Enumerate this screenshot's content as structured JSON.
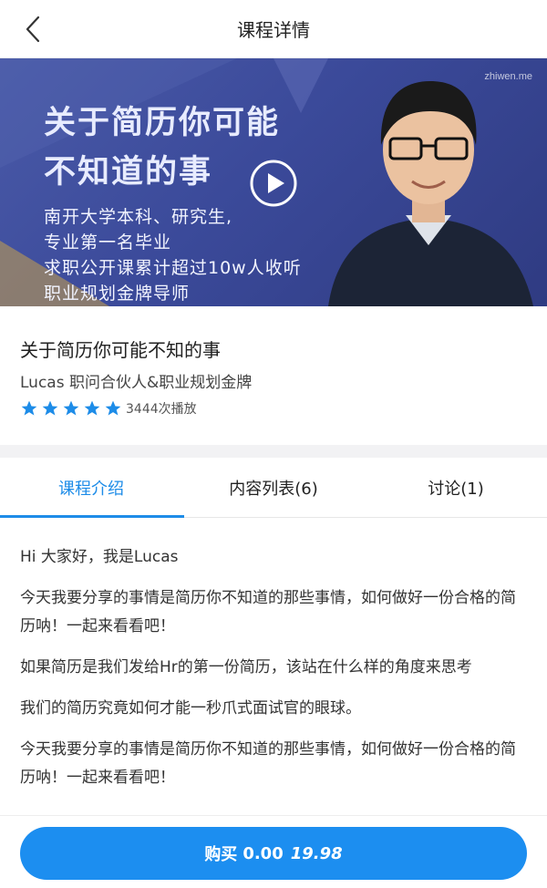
{
  "nav": {
    "title": "课程详情",
    "back_icon": "chevron-left-icon"
  },
  "banner": {
    "headline": "关于简历你可能\n不知道的事",
    "bullets": [
      "南开大学本科、研究生,",
      "专业第一名毕业",
      "求职公开课累计超过10w人收听",
      "职业规划金牌导师"
    ],
    "brand": "zhiwen.me",
    "play_icon": "play-icon"
  },
  "course": {
    "title": "关于简历你可能不知的事",
    "author": "Lucas 职问合伙人&职业规划金牌",
    "rating": 5,
    "plays": "3444次播放"
  },
  "tabs": [
    {
      "label": "课程介绍",
      "active": true
    },
    {
      "label": "内容列表(6)",
      "active": false
    },
    {
      "label": "讨论(1)",
      "active": false
    }
  ],
  "content": [
    "Hi 大家好，我是Lucas",
    "今天我要分享的事情是简历你不知道的那些事情，如何做好一份合格的简历呐！一起来看看吧！",
    "如果简历是我们发给Hr的第一份简历，该站在什么样的角度来思考",
    "我们的简历究竟如何才能一秒爪式面试官的眼球。",
    "今天我要分享的事情是简历你不知道的那些事情，如何做好一份合格的简历呐！一起来看看吧！"
  ],
  "buy": {
    "label": "购买",
    "price": "0.00",
    "original_price": "19.98"
  },
  "colors": {
    "accent": "#1c8ef0",
    "banner_bg": "#3b4a9a",
    "star": "#1d8ce8"
  }
}
